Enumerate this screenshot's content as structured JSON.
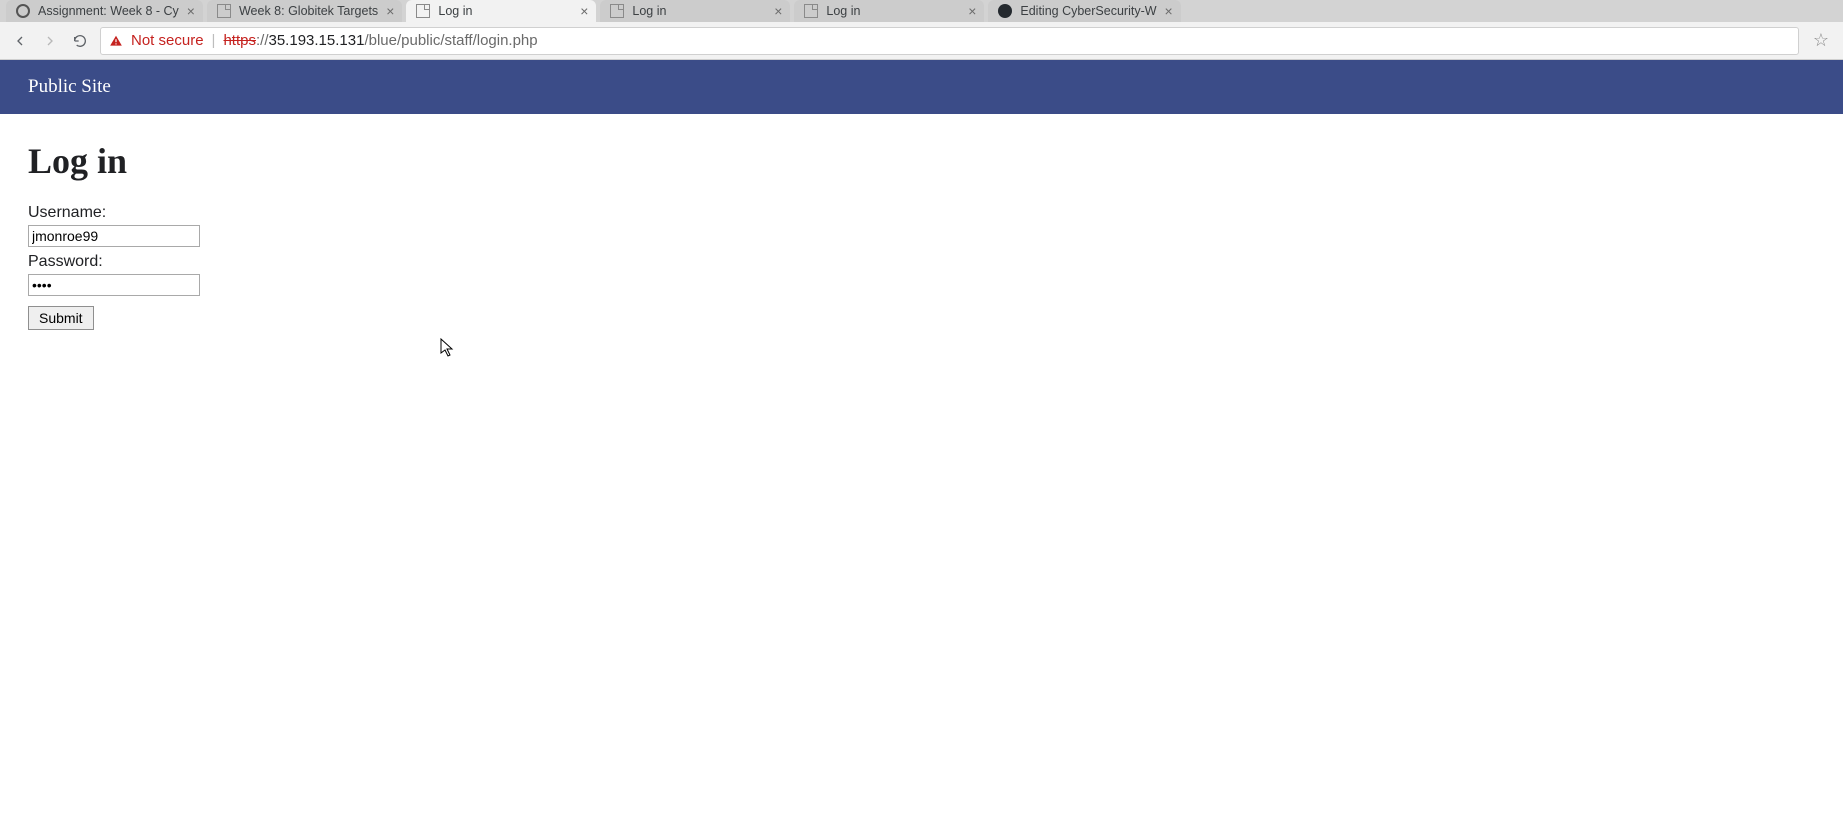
{
  "tabs": [
    {
      "title": "Assignment: Week 8 - Cy",
      "icon": "circle-c"
    },
    {
      "title": "Week 8: Globitek Targets",
      "icon": "page"
    },
    {
      "title": "Log in",
      "icon": "page",
      "active": true
    },
    {
      "title": "Log in",
      "icon": "page"
    },
    {
      "title": "Log in",
      "icon": "page"
    },
    {
      "title": "Editing CyberSecurity-W",
      "icon": "github"
    }
  ],
  "toolbar": {
    "secure_text": "Not secure",
    "url_https": "https",
    "url_sep": "://",
    "url_host": "35.193.15.131",
    "url_path": "/blue/public/staff/login.php"
  },
  "page": {
    "public_site": "Public Site",
    "heading": "Log in",
    "username_label": "Username:",
    "username_value": "jmonroe99",
    "password_label": "Password:",
    "password_value": "••••",
    "submit_label": "Submit"
  }
}
